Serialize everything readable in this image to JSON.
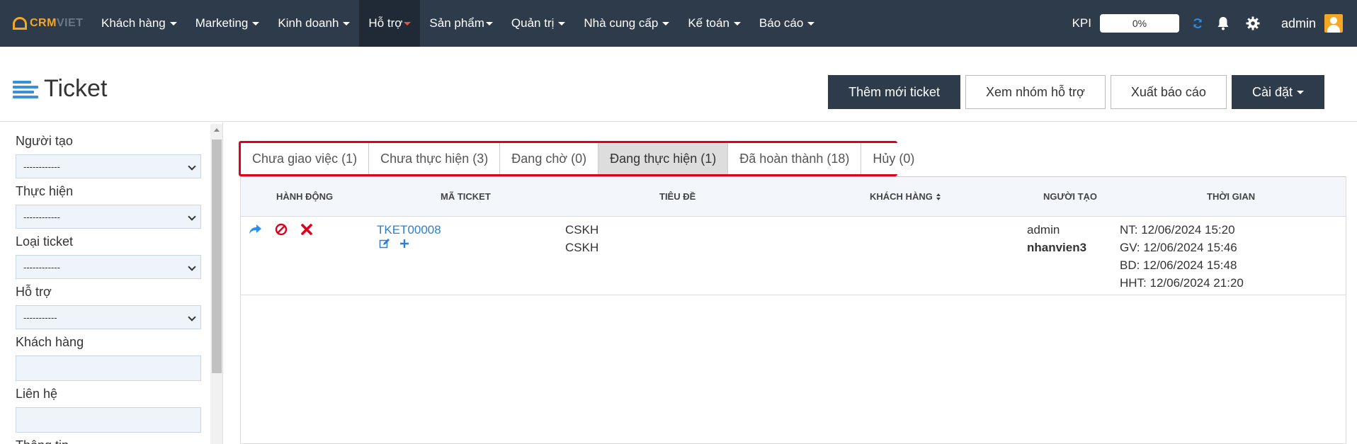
{
  "app": {
    "logo_crm": "CRM",
    "logo_viet": "VIET",
    "colors": {
      "nav_bg": "#2d3b4a",
      "accent": "#2b7fd1",
      "logo": "#f5a623",
      "highlight": "#e0001a"
    }
  },
  "nav": {
    "items": [
      {
        "label": "Khách hàng",
        "active": false
      },
      {
        "label": "Marketing",
        "active": false
      },
      {
        "label": "Kinh doanh",
        "active": false
      },
      {
        "label": "Hỗ trợ",
        "active": true
      },
      {
        "label": "Sản phẩm",
        "active": false
      },
      {
        "label": "Quản trị",
        "active": false
      },
      {
        "label": "Nhà cung cấp",
        "active": false
      },
      {
        "label": "Kế toán",
        "active": false
      },
      {
        "label": "Báo cáo",
        "active": false
      }
    ],
    "kpi_label": "KPI",
    "kpi_value": "0%",
    "user": "admin",
    "icons": [
      "refresh-icon",
      "bell-icon",
      "gear-icon",
      "user-avatar-icon"
    ]
  },
  "header": {
    "title": "Ticket",
    "buttons": {
      "add": "Thêm mới ticket",
      "groups": "Xem nhóm hỗ trợ",
      "export": "Xuất báo cáo",
      "settings": "Cài đặt"
    }
  },
  "filters": {
    "creator_label": "Người tạo",
    "creator_value": "------------",
    "assignee_label": "Thực hiện",
    "assignee_value": "------------",
    "type_label": "Loại ticket",
    "type_value": "------------",
    "support_label": "Hỗ trợ",
    "support_value": "-----------",
    "customer_label": "Khách hàng",
    "customer_value": "",
    "contact_label": "Liên hệ",
    "contact_value": "",
    "more_label": "Thông tin"
  },
  "tabs": [
    {
      "label": "Chưa giao việc (1)",
      "active": false
    },
    {
      "label": "Chưa thực hiện (3)",
      "active": false
    },
    {
      "label": "Đang chờ (0)",
      "active": false
    },
    {
      "label": "Đang thực hiện (1)",
      "active": true
    },
    {
      "label": "Đã hoàn thành (18)",
      "active": false
    },
    {
      "label": "Hủy (0)",
      "active": false
    }
  ],
  "table": {
    "columns": {
      "actions": "HÀNH ĐỘNG",
      "code": "MÃ TICKET",
      "title": "TIÊU ĐỀ",
      "customer": "KHÁCH HÀNG",
      "creator": "NGƯỜI TẠO",
      "time": "THỜI GIAN"
    },
    "rows": [
      {
        "code": "TKET00008",
        "title_line1": "CSKH",
        "title_line2": "CSKH",
        "customer": "",
        "creator": "admin",
        "assignee": "nhanvien3",
        "time_nt": "NT: 12/06/2024 15:20",
        "time_gv": "GV: 12/06/2024 15:46",
        "time_bd": "BD: 12/06/2024 15:48",
        "time_hht": "HHT: 12/06/2024 21:20"
      }
    ]
  }
}
